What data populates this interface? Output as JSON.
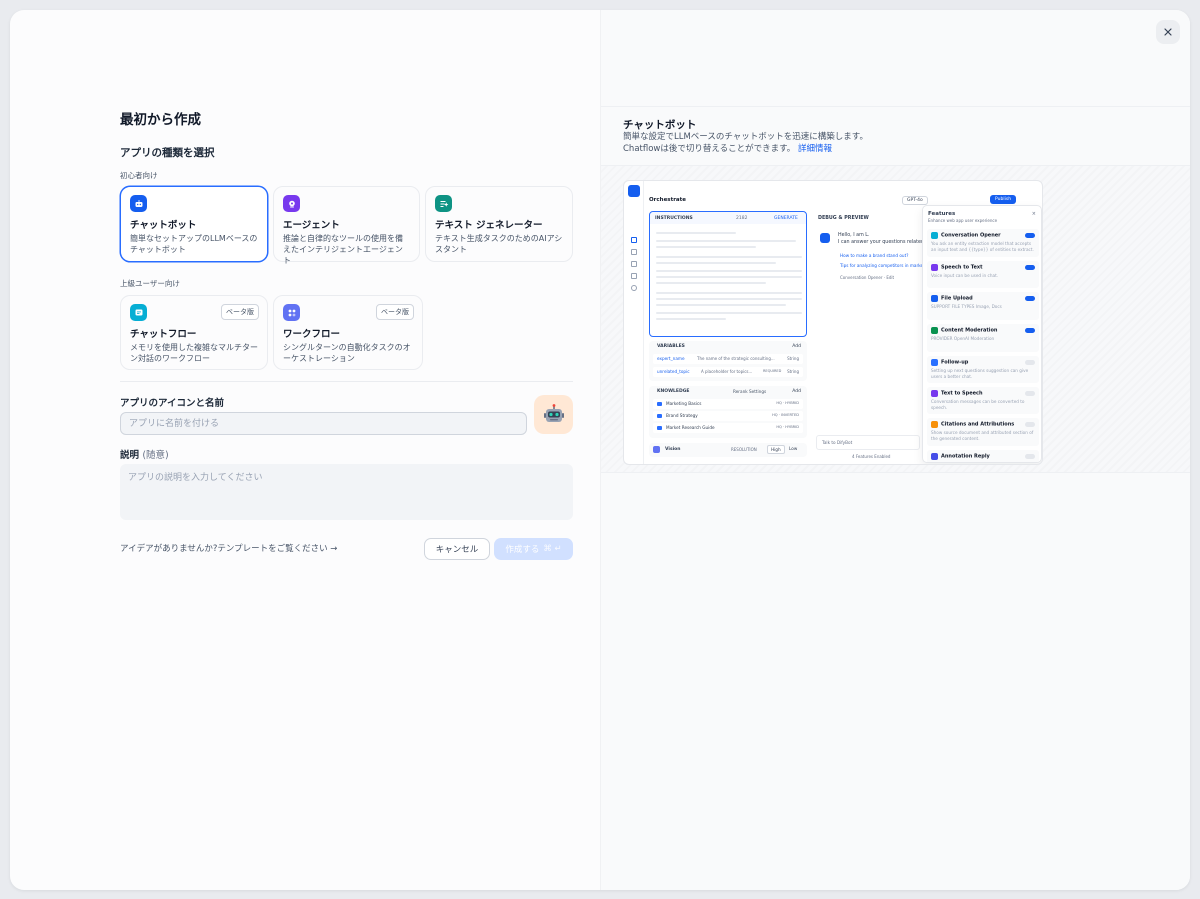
{
  "header": {
    "title": "最初から作成"
  },
  "app_type": {
    "section_title": "アプリの種類を選択",
    "beginner_label": "初心者向け",
    "advanced_label": "上級ユーザー向け",
    "beginner": [
      {
        "title": "チャットボット",
        "desc": "簡単なセットアップのLLMベースのチャットボット",
        "color": "#155eef"
      },
      {
        "title": "エージェント",
        "desc": "推論と自律的なツールの使用を備えたインテリジェントエージェント",
        "color": "#7839ee"
      },
      {
        "title": "テキスト ジェネレーター",
        "desc": "テキスト生成タスクのためのAIアシスタント",
        "color": "#0e9384"
      }
    ],
    "advanced": [
      {
        "title": "チャットフロー",
        "desc": "メモリを使用した複雑なマルチターン対話のワークフロー",
        "badge": "ベータ版",
        "color": "#06aed4"
      },
      {
        "title": "ワークフロー",
        "desc": "シングルターンの自動化タスクのオーケストレーション",
        "badge": "ベータ版",
        "color": "#6172f3"
      }
    ]
  },
  "name_field": {
    "label": "アプリのアイコンと名前",
    "placeholder": "アプリに名前を付ける",
    "icon_bg": "#ffe8d5"
  },
  "desc_field": {
    "label": "説明",
    "optional": "(随意)",
    "placeholder": "アプリの説明を入力してください"
  },
  "footer": {
    "idea_link": "アイデアがありませんか?テンプレートをご覧ください",
    "cancel": "キャンセル",
    "create": "作成する",
    "create_shortcut": "⌘ ↵"
  },
  "preview": {
    "title": "チャットボット",
    "desc_line1": "簡単な設定でLLMベースのチャットボットを迅速に構築します。",
    "desc_line2": "Chatflowは後で切り替えることができます。",
    "learn_more": "詳細情報",
    "shot": {
      "orchestrate": "Orchestrate",
      "model": "GPT-4o",
      "publish": "Publish",
      "instructions": "INSTRUCTIONS",
      "instructions_count": "2182",
      "generate": "GENERATE",
      "debug": "DEBUG & PREVIEW",
      "greeting1": "Hello, I am L.",
      "greeting2": "I can answer your questions related",
      "suggestion1": "How to make a brand stand out?",
      "suggestion2": "Tips for analyzing competitors in marke",
      "opener": "Conversation Opener",
      "edit": "Edit",
      "variables": "VARIABLES",
      "add": "Add",
      "var1_name": "expert_name",
      "var1_desc": "The name of the strategic consulting...",
      "var1_type": "String",
      "var2_name": "unrelated_topic",
      "var2_desc": "A placeholder for topics...",
      "var2_req": "REQUIRED",
      "var2_type": "String",
      "knowledge": "KNOWLEDGE",
      "rerank": "Rerank Settings",
      "kb1": "Marketing Basics",
      "kb2": "Brand Strategy",
      "kb3": "Market Research Guide",
      "kb_tag1": "HQ · HYBRID",
      "kb_tag2": "HQ · INVERTED",
      "kb_tag3": "HQ · HYBRID",
      "vision": "Vision",
      "resolution": "RESOLUTION",
      "high": "High",
      "low": "Low",
      "talk": "Talk to DifyBot",
      "features_enabled": "4 Features Enabled",
      "features_title": "Features",
      "features_sub": "Enhance web app user experience",
      "features": [
        {
          "name": "Conversation Opener",
          "desc": "You ask an entity extraction model that accepts an input text and {{type}} of entities to extract."
        },
        {
          "name": "Speech to Text",
          "desc": "Voice input can be used in chat."
        },
        {
          "name": "File Upload",
          "desc": "SUPPORT FILE TYPES  Image, Docs"
        },
        {
          "name": "Content Moderation",
          "desc": "PROVIDER OpenAI Moderation"
        },
        {
          "name": "Follow-up",
          "desc": "Setting up next questions suggestion can give users a better chat."
        },
        {
          "name": "Text to Speech",
          "desc": "Conversation messages can be converted to speech."
        },
        {
          "name": "Citations and Attributions",
          "desc": "Show source document and attributed section of the generated content."
        },
        {
          "name": "Annotation Reply",
          "desc": ""
        }
      ]
    }
  }
}
